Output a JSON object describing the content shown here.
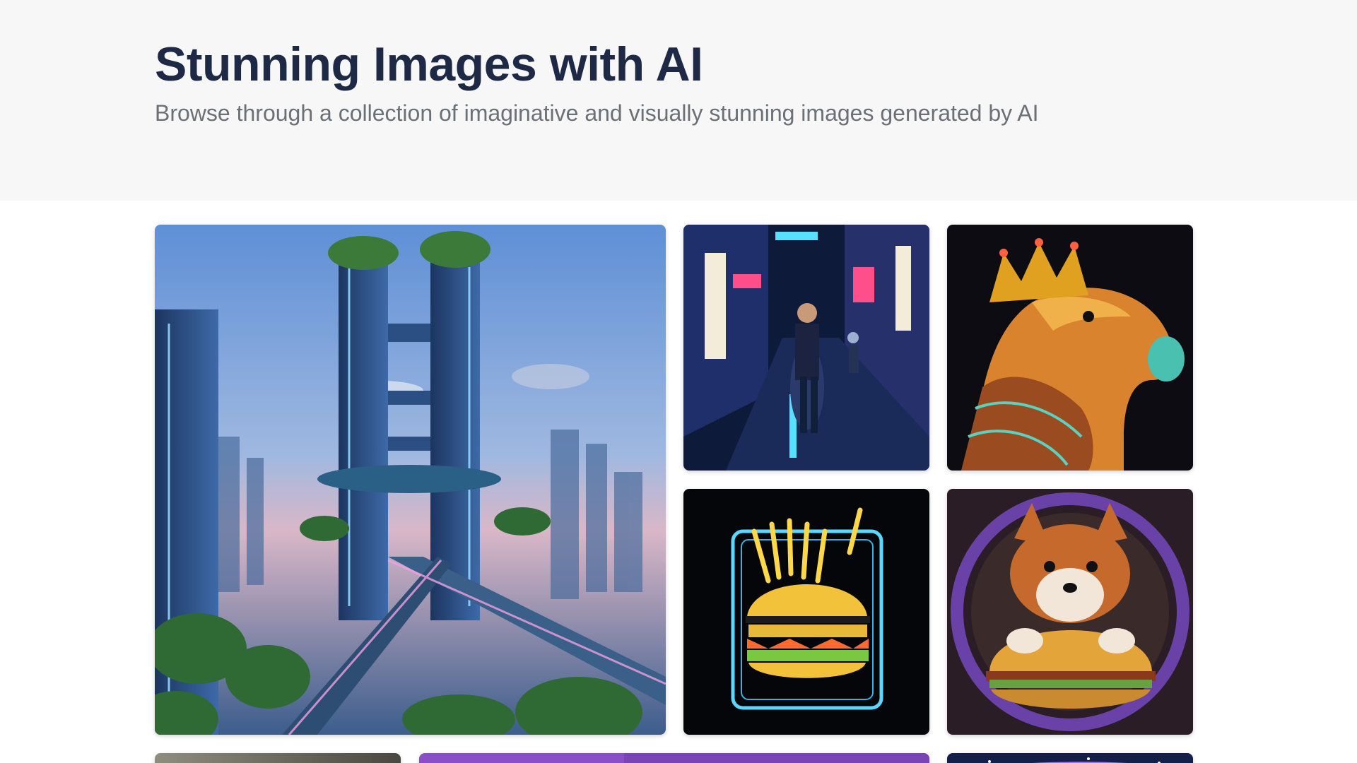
{
  "header": {
    "title": "Stunning Images with AI",
    "subtitle": "Browse through a collection of imaginative and visually stunning images generated by AI"
  },
  "gallery": {
    "images": [
      {
        "subject": "futuristic neon city with sky gardens",
        "icon": "image-icon"
      },
      {
        "subject": "isometric neon street at night",
        "icon": "image-icon"
      },
      {
        "subject": "capybara wearing a crown",
        "icon": "image-icon"
      },
      {
        "subject": "neon burger and fries sign",
        "icon": "image-icon"
      },
      {
        "subject": "shiba dog with a burger",
        "icon": "image-icon"
      },
      {
        "subject": "partially visible image",
        "icon": "image-icon"
      },
      {
        "subject": "partially visible purple image",
        "icon": "image-icon"
      },
      {
        "subject": "partially visible space image",
        "icon": "image-icon"
      }
    ]
  },
  "colors": {
    "header_bg": "#f7f7f7",
    "title": "#1e2a45",
    "subtitle": "#6b6f76",
    "page_bg": "#ffffff"
  }
}
